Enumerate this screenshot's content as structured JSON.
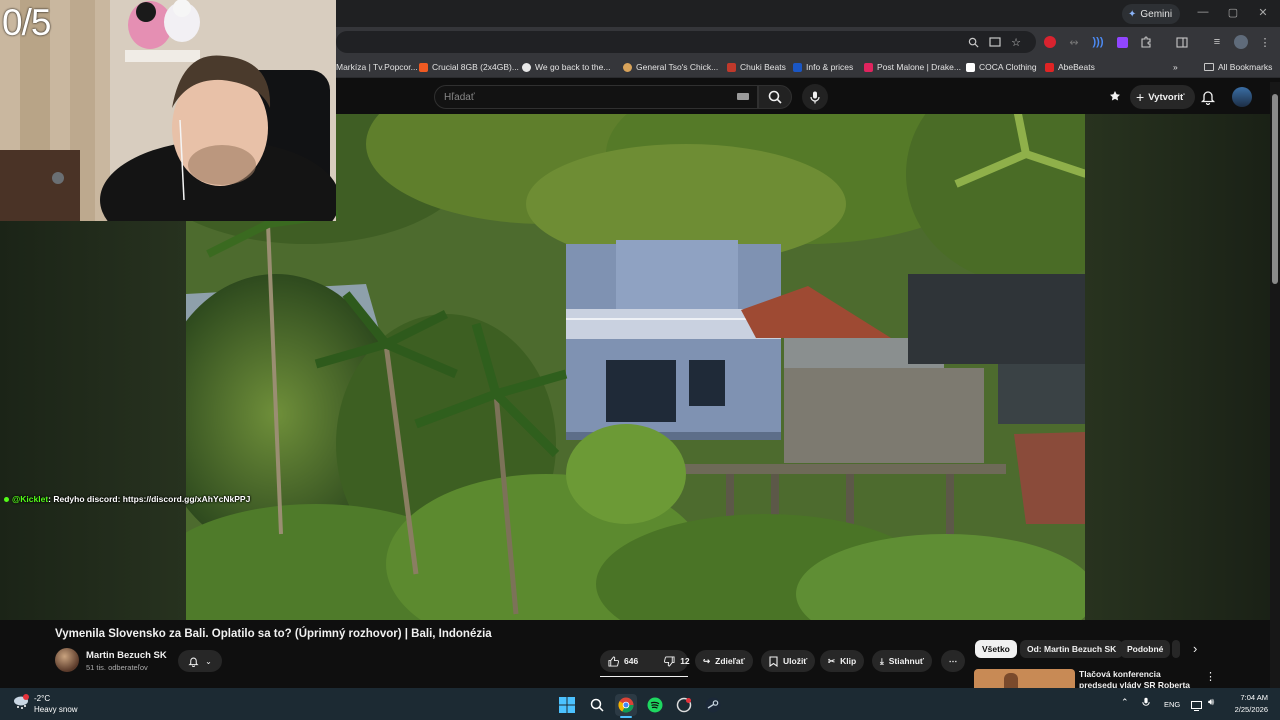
{
  "browser": {
    "gemini_label": "Gemini",
    "search_placeholder": "Hľadať",
    "bookmarks": [
      {
        "label": "Markíza | Tv.Popcor...",
        "color": "#ffffff"
      },
      {
        "label": "Crucial 8GB (2x4GB)...",
        "color": "#f05a22"
      },
      {
        "label": "We go back to the...",
        "color": "#e8e8e8"
      },
      {
        "label": "General Tso's Chick...",
        "color": "#d8a35a"
      },
      {
        "label": "Chuki Beats",
        "color": "#c0392b"
      },
      {
        "label": "Info & prices",
        "color": "#1a56c4"
      },
      {
        "label": "Post Malone | Drake...",
        "color": "#e0245e"
      },
      {
        "label": "COCA Clothing",
        "color": "#222222"
      },
      {
        "label": "AbeBeats",
        "color": "#e02424"
      }
    ],
    "all_bookmarks_label": "All Bookmarks"
  },
  "youtube": {
    "create_label": "Vytvoriť",
    "video_title": "Vymenila Slovensko za Bali. Oplatilo sa to? (Úprimný rozhovor) | Bali, Indonézia",
    "channel_name": "Martin Bezuch SK",
    "subscribers": "51 tis. odberateľov",
    "likes": "646",
    "dislikes": "12",
    "share_label": "Zdieľať",
    "save_label": "Uložiť",
    "clip_label": "Klip",
    "download_label": "Stiahnuť",
    "chips": [
      "Všetko",
      "Od: Martin Bezuch SK",
      "Podobné"
    ],
    "recommendation_title": "Tlačová konferencia predsedu vlády SR Roberta Fica po"
  },
  "overlay": {
    "counter": "0/5",
    "chat_user": "@Kicklet",
    "chat_message": ": Redyho discord: https://discord.gg/xAhYcNkPPJ"
  },
  "taskbar": {
    "temperature": "-2°C",
    "condition": "Heavy snow",
    "language": "ENG",
    "time": "7:04 AM",
    "date": "2/25/2026"
  },
  "colors": {
    "youtube_bg": "#0f0f0f",
    "kick_green": "#53fc18",
    "taskbar": "#1c2a33"
  }
}
